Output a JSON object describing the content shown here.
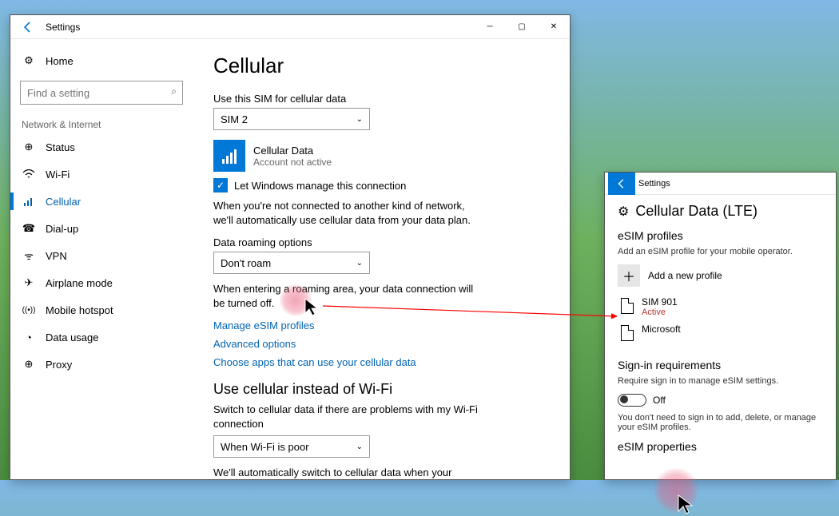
{
  "main_window": {
    "title": "Settings",
    "sidebar": {
      "home": "Home",
      "search_placeholder": "Find a setting",
      "group": "Network & Internet",
      "items": [
        {
          "icon": "status-icon",
          "label": "Status"
        },
        {
          "icon": "wifi-icon",
          "label": "Wi-Fi"
        },
        {
          "icon": "cellular-icon",
          "label": "Cellular",
          "selected": true
        },
        {
          "icon": "dialup-icon",
          "label": "Dial-up"
        },
        {
          "icon": "vpn-icon",
          "label": "VPN"
        },
        {
          "icon": "airplane-icon",
          "label": "Airplane mode"
        },
        {
          "icon": "hotspot-icon",
          "label": "Mobile hotspot"
        },
        {
          "icon": "datausage-icon",
          "label": "Data usage"
        },
        {
          "icon": "proxy-icon",
          "label": "Proxy"
        }
      ]
    },
    "page": {
      "title": "Cellular",
      "sim_label": "Use this SIM for cellular data",
      "sim_value": "SIM 2",
      "data_tile_title": "Cellular Data",
      "data_tile_status": "Account not active",
      "manage_checkbox": "Let Windows manage this connection",
      "manage_desc": "When you're not connected to another kind of network, we'll automatically use cellular data from your data plan.",
      "roaming_label": "Data roaming options",
      "roaming_value": "Don't roam",
      "roaming_desc": "When entering a roaming area, your data connection will be turned off.",
      "link_esim": "Manage eSIM profiles",
      "link_adv": "Advanced options",
      "link_apps": "Choose apps that can use your cellular data",
      "fallback_title": "Use cellular instead of Wi-Fi",
      "fallback_desc1": "Switch to cellular data if there are problems with my Wi-Fi connection",
      "fallback_value": "When Wi-Fi is poor",
      "fallback_desc2": "We'll automatically switch to cellular data when your Internet connection over Wi-Fi is poor. This will use your data plan and may incur charges."
    }
  },
  "sec_window": {
    "title": "Settings",
    "page_title": "Cellular Data (LTE)",
    "profiles_heading": "eSIM profiles",
    "profiles_desc": "Add an eSIM profile for your mobile operator.",
    "add_label": "Add a new profile",
    "profiles": [
      {
        "name": "SIM 901",
        "status": "Active"
      },
      {
        "name": "Microsoft"
      }
    ],
    "signin_heading": "Sign-in requirements",
    "signin_desc": "Require sign in to manage eSIM settings.",
    "toggle_label": "Off",
    "signin_note": "You don't need to sign in to add, delete, or manage your eSIM profiles.",
    "props_heading": "eSIM properties"
  },
  "icons": {
    "home": "⚙",
    "status": "⊕",
    "wifi": "⸨",
    "cellular": "📶",
    "dialup": "◔",
    "vpn": "ᯤ",
    "airplane": "✈",
    "hotspot": "((•))",
    "datausage": "◐",
    "proxy": "⊕",
    "settings": "⚙"
  }
}
